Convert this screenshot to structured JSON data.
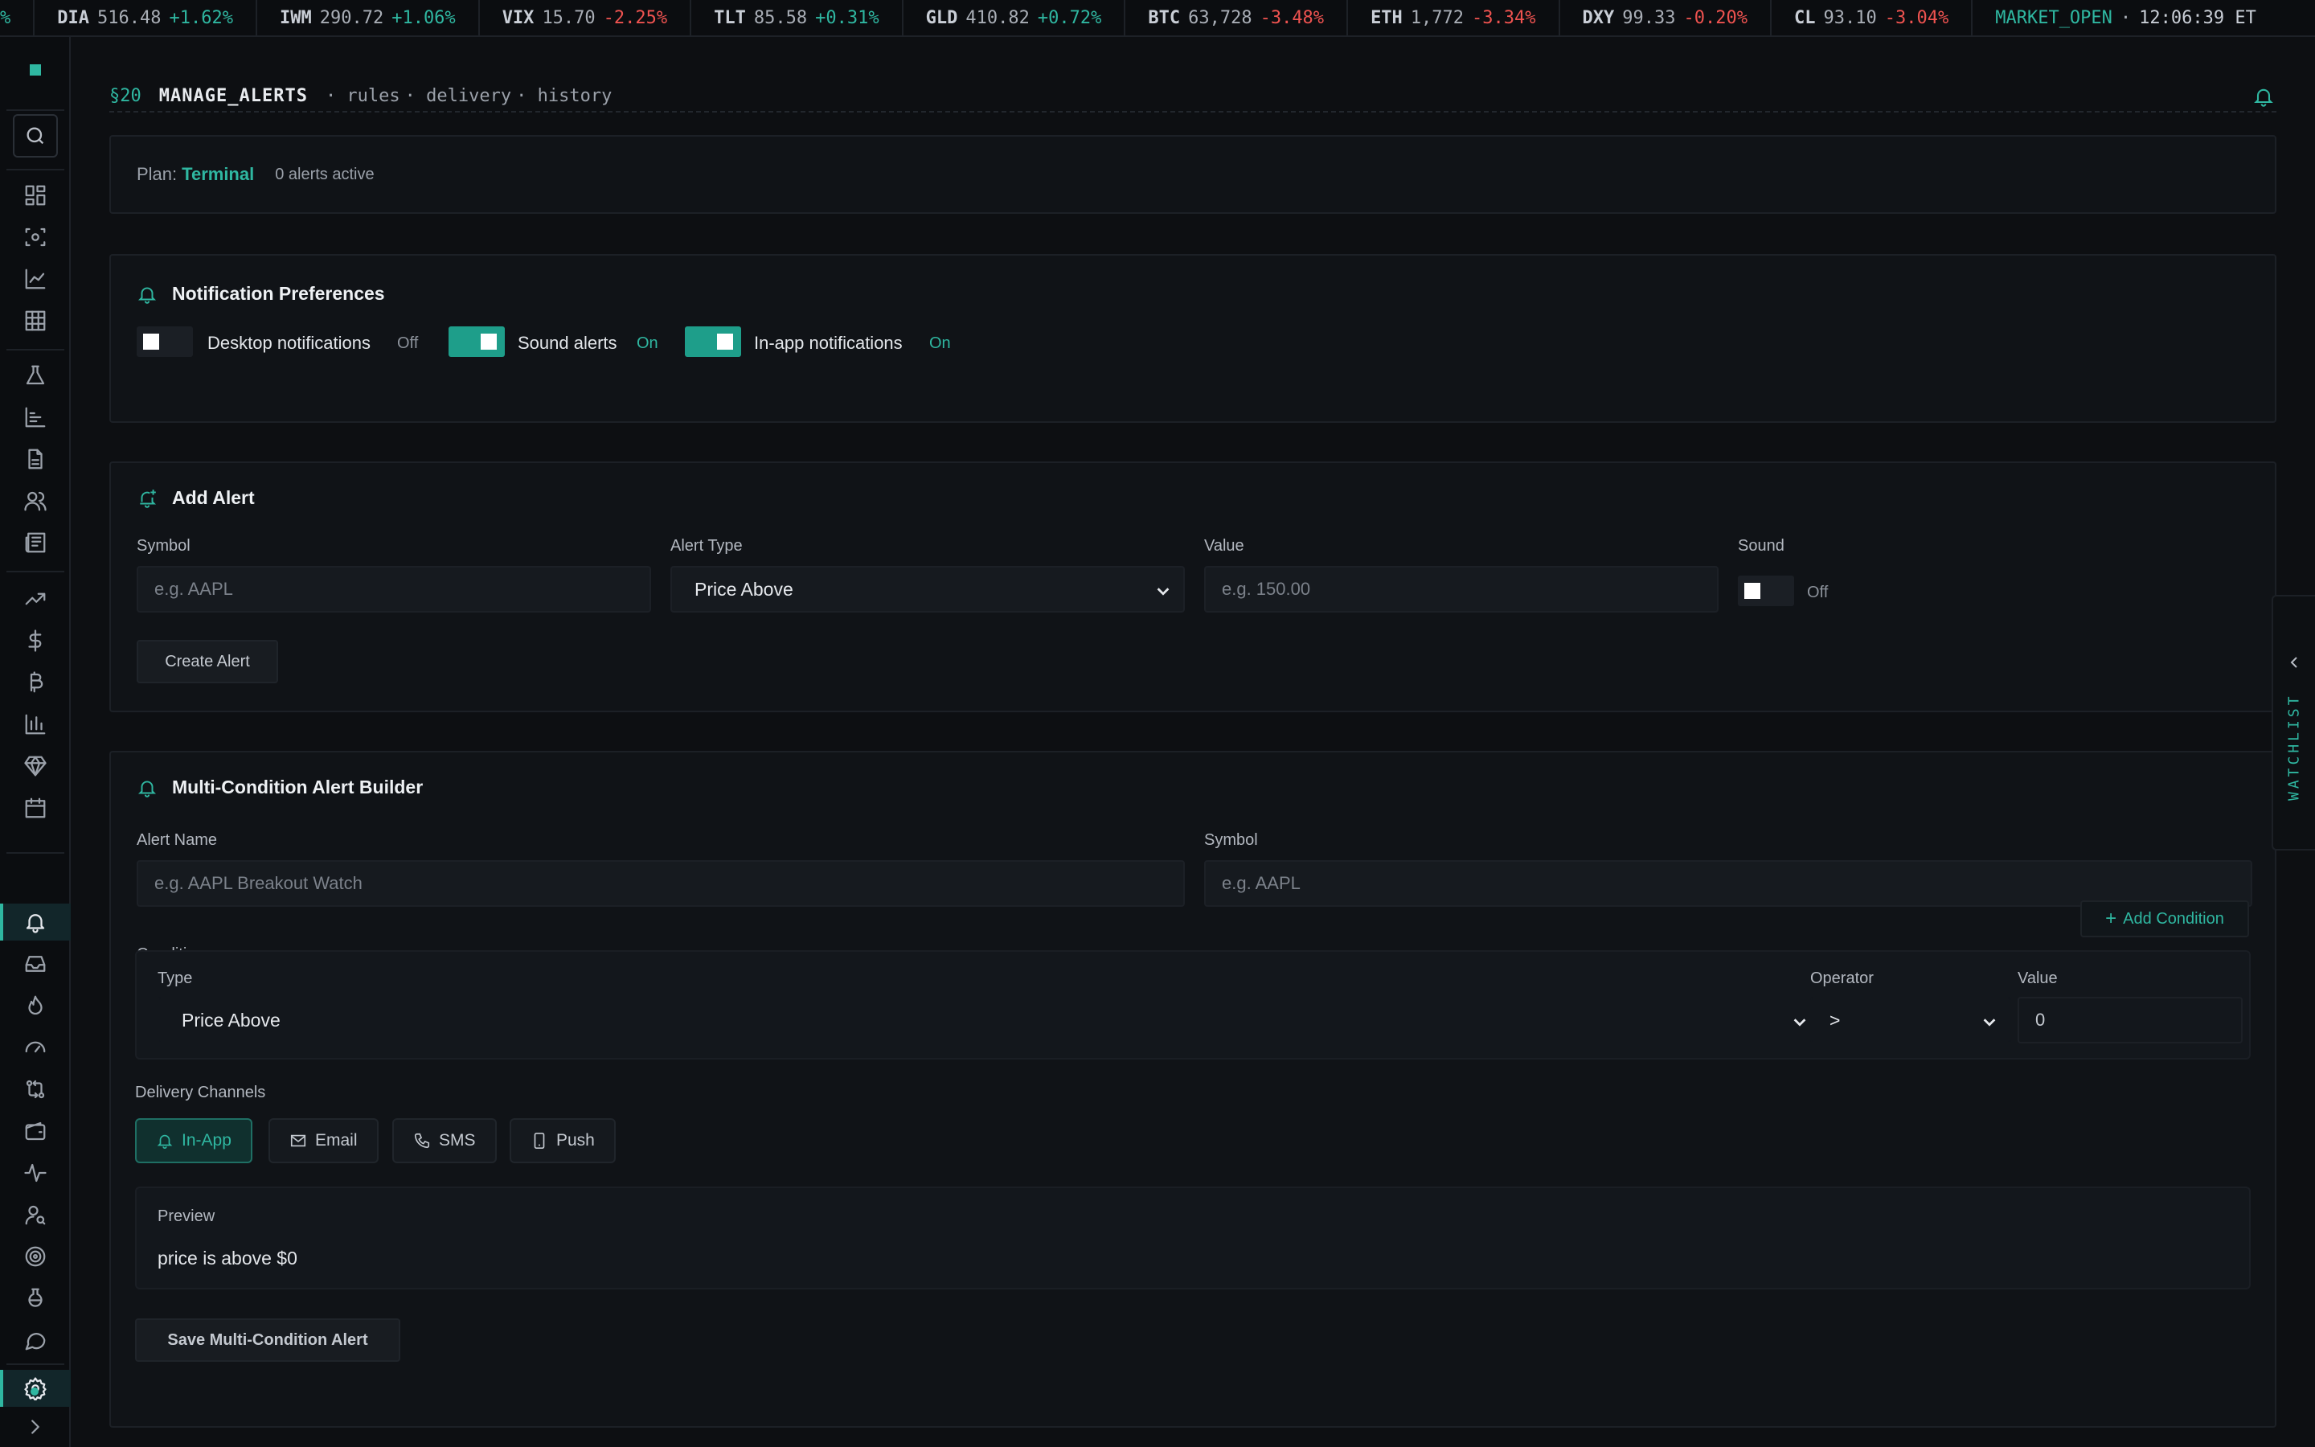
{
  "ticker": [
    {
      "sym": "",
      "price": "",
      "chg": "%",
      "dir": "up"
    },
    {
      "sym": "DIA",
      "price": "516.48",
      "chg": "+1.62%",
      "dir": "up"
    },
    {
      "sym": "IWM",
      "price": "290.72",
      "chg": "+1.06%",
      "dir": "up"
    },
    {
      "sym": "VIX",
      "price": "15.70",
      "chg": "-2.25%",
      "dir": "dn"
    },
    {
      "sym": "TLT",
      "price": "85.58",
      "chg": "+0.31%",
      "dir": "up"
    },
    {
      "sym": "GLD",
      "price": "410.82",
      "chg": "+0.72%",
      "dir": "up"
    },
    {
      "sym": "BTC",
      "price": "63,728",
      "chg": "-3.48%",
      "dir": "dn"
    },
    {
      "sym": "ETH",
      "price": "1,772",
      "chg": "-3.34%",
      "dir": "dn"
    },
    {
      "sym": "DXY",
      "price": "99.33",
      "chg": "-0.20%",
      "dir": "dn"
    },
    {
      "sym": "CL",
      "price": "93.10",
      "chg": "-3.04%",
      "dir": "dn"
    }
  ],
  "market": {
    "status": "MARKET_OPEN",
    "sep": "·",
    "time": "12:06:39 ET"
  },
  "sidebar": {
    "items": [
      "dashboard-icon",
      "scan-icon",
      "chart-line-icon",
      "grid-icon",
      "flask-icon",
      "bar-list-icon",
      "document-icon",
      "users-icon",
      "newspaper-icon",
      "trending-up-icon",
      "dollar-icon",
      "bitcoin-icon",
      "bar-chart-icon",
      "diamond-icon",
      "calendar-icon",
      "bell-icon",
      "inbox-icon",
      "flame-icon",
      "gauge-icon",
      "swap-icon",
      "wallet-icon",
      "pulse-icon",
      "user-search-icon",
      "target-icon",
      "beaker-icon",
      "chat-icon",
      "gear-icon"
    ],
    "active": "bell-icon"
  },
  "header": {
    "section": "§20",
    "title": "MANAGE_ALERTS",
    "crumbs": [
      "· rules",
      "· delivery",
      "· history"
    ]
  },
  "plan": {
    "label": "Plan:",
    "tier": "Terminal",
    "count": "0 alerts active"
  },
  "prefs": {
    "title": "Notification Preferences",
    "desktop": {
      "label": "Desktop notifications",
      "state": "Off"
    },
    "sound": {
      "label": "Sound alerts",
      "state": "On"
    },
    "inapp": {
      "label": "In-app notifications",
      "state": "On"
    }
  },
  "add_alert": {
    "title": "Add Alert",
    "symbol_label": "Symbol",
    "symbol_placeholder": "e.g. AAPL",
    "type_label": "Alert Type",
    "type_value": "Price Above",
    "value_label": "Value",
    "value_placeholder": "e.g. 150.00",
    "sound_label": "Sound",
    "sound_state": "Off",
    "create_label": "Create Alert"
  },
  "multi": {
    "title": "Multi-Condition Alert Builder",
    "name_label": "Alert Name",
    "name_placeholder": "e.g. AAPL Breakout Watch",
    "symbol_label": "Symbol",
    "symbol_placeholder": "e.g. AAPL",
    "conditions_label": "Conditions",
    "add_condition": "Add Condition",
    "cond_type_label": "Type",
    "cond_type_value": "Price Above",
    "operator_label": "Operator",
    "operator_value": ">",
    "value_label": "Value",
    "value_value": "0",
    "delivery_label": "Delivery Channels",
    "channels": [
      {
        "label": "In-App",
        "active": true
      },
      {
        "label": "Email",
        "active": false
      },
      {
        "label": "SMS",
        "active": false
      },
      {
        "label": "Push",
        "active": false
      }
    ],
    "preview_label": "Preview",
    "preview_text": "price is above $0",
    "save_label": "Save Multi-Condition Alert"
  },
  "watchlist": {
    "label": "WATCHLIST"
  },
  "colors": {
    "accent": "#2fb7a1",
    "down": "#ef5350",
    "bg": "#0d0f12"
  }
}
